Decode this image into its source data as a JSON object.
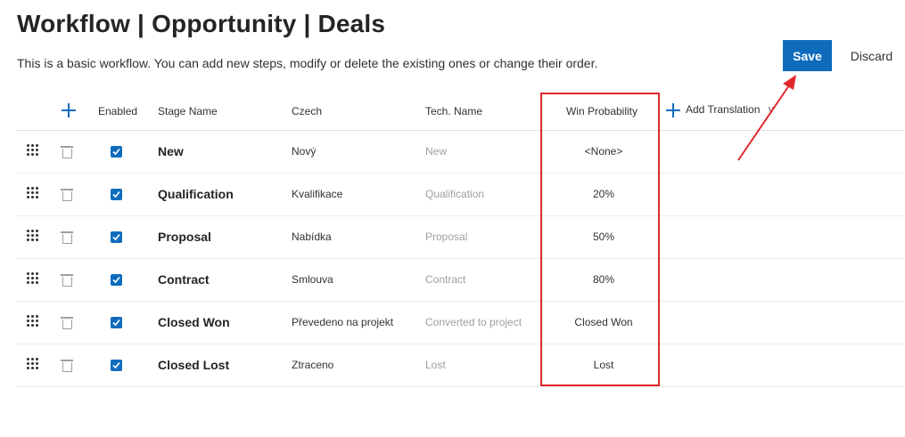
{
  "page": {
    "title": "Workflow | Opportunity | Deals",
    "subtitle": "This is a basic workflow. You can add new steps, modify or delete the existing ones or change their order."
  },
  "actions": {
    "save": "Save",
    "discard": "Discard"
  },
  "table": {
    "headers": {
      "enabled": "Enabled",
      "stage_name": "Stage Name",
      "czech": "Czech",
      "tech_name": "Tech. Name",
      "win_probability": "Win Probability",
      "add_translation": "Add Translation"
    },
    "rows": [
      {
        "enabled": true,
        "stage": "New",
        "czech": "Nový",
        "tech": "New",
        "probability": "<None>"
      },
      {
        "enabled": true,
        "stage": "Qualification",
        "czech": "Kvalifikace",
        "tech": "Qualification",
        "probability": "20%"
      },
      {
        "enabled": true,
        "stage": "Proposal",
        "czech": "Nabídka",
        "tech": "Proposal",
        "probability": "50%"
      },
      {
        "enabled": true,
        "stage": "Contract",
        "czech": "Smlouva",
        "tech": "Contract",
        "probability": "80%"
      },
      {
        "enabled": true,
        "stage": "Closed Won",
        "czech": "Převedeno na projekt",
        "tech": "Converted to project",
        "probability": "Closed Won"
      },
      {
        "enabled": true,
        "stage": "Closed Lost",
        "czech": "Ztraceno",
        "tech": "Lost",
        "probability": "Lost"
      }
    ]
  },
  "icons": {
    "add_step": "plus-icon",
    "add_translation": "plus-icon",
    "dropdown": "chevron-down-icon",
    "drag": "drag-handle-icon",
    "delete": "trash-icon",
    "checkbox": "checkbox-checked-icon"
  },
  "colors": {
    "accent": "#0f6cbd",
    "annotation": "#e0282c"
  }
}
